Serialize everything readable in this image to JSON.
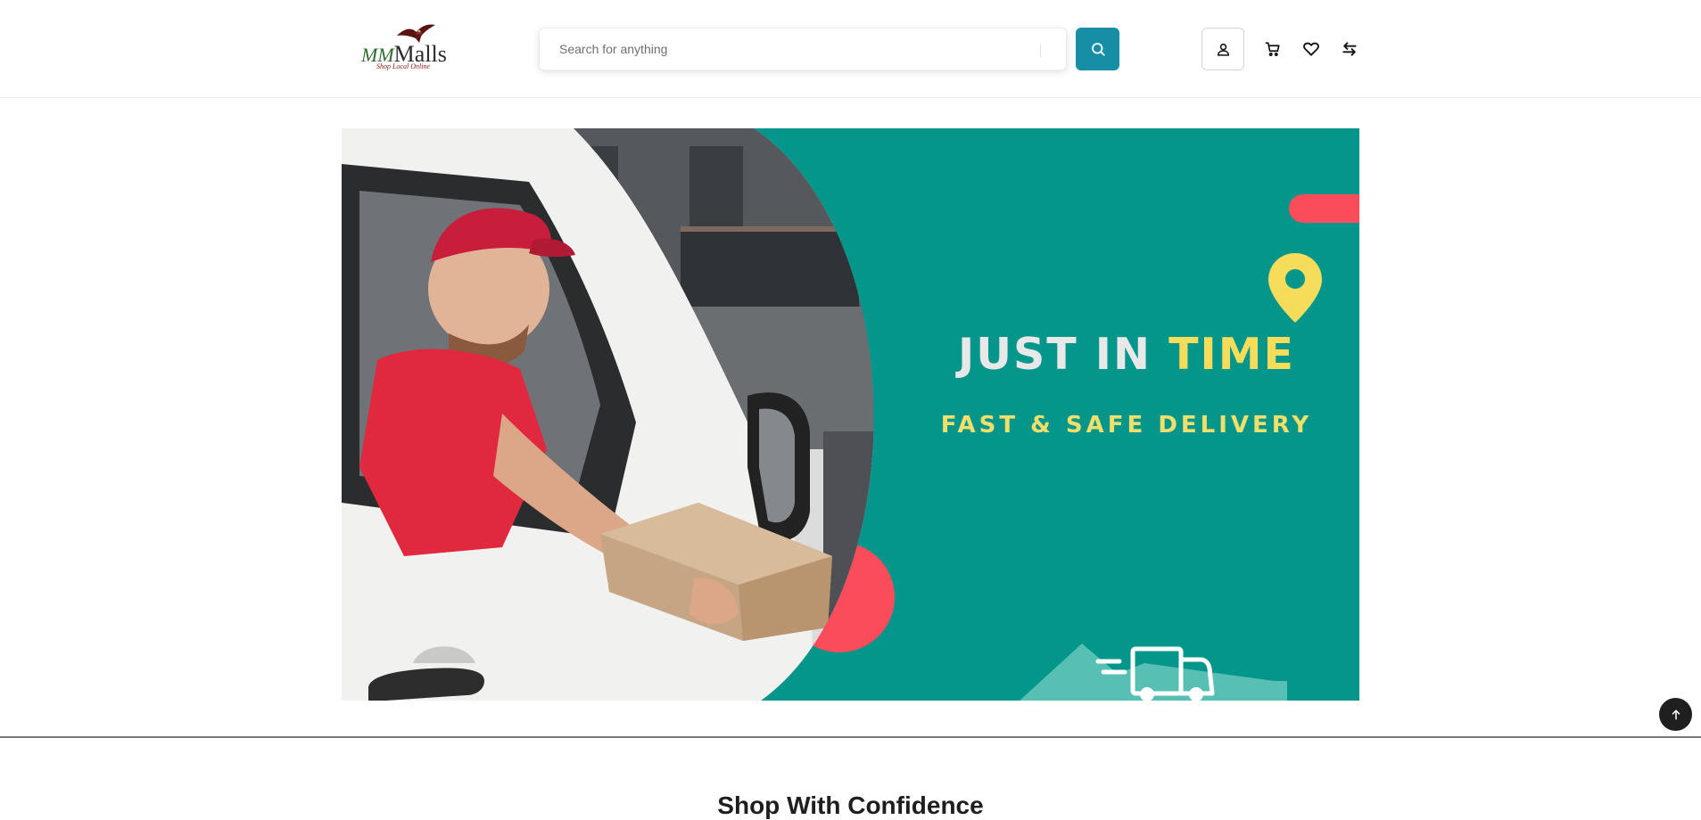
{
  "header": {
    "logo": {
      "brand_prefix": "MM",
      "brand_name": "Malls",
      "tagline": "Shop Local Online",
      "icon": "eagle-logo-icon"
    },
    "search": {
      "placeholder": "Search for anything",
      "value": "",
      "button_icon": "search-icon"
    },
    "actions": {
      "account_icon": "user-icon",
      "cart_icon": "cart-icon",
      "wishlist_icon": "heart-icon",
      "compare_icon": "compare-arrows-icon"
    }
  },
  "banner": {
    "headline_part1": "JUST IN ",
    "headline_part2": "TIME",
    "subline": "FAST & SAFE DELIVERY",
    "pin_icon": "location-pin-icon",
    "truck_icon": "delivery-truck-icon"
  },
  "scroll_top_icon": "arrow-up-icon",
  "section": {
    "title": "Shop With Confidence"
  },
  "colors": {
    "accent": "#168fa6",
    "banner_teal": "#04968a",
    "banner_yellow": "#f5dd5b",
    "banner_coral": "#fb4c5b",
    "truck_hills": "#57bfb3"
  }
}
